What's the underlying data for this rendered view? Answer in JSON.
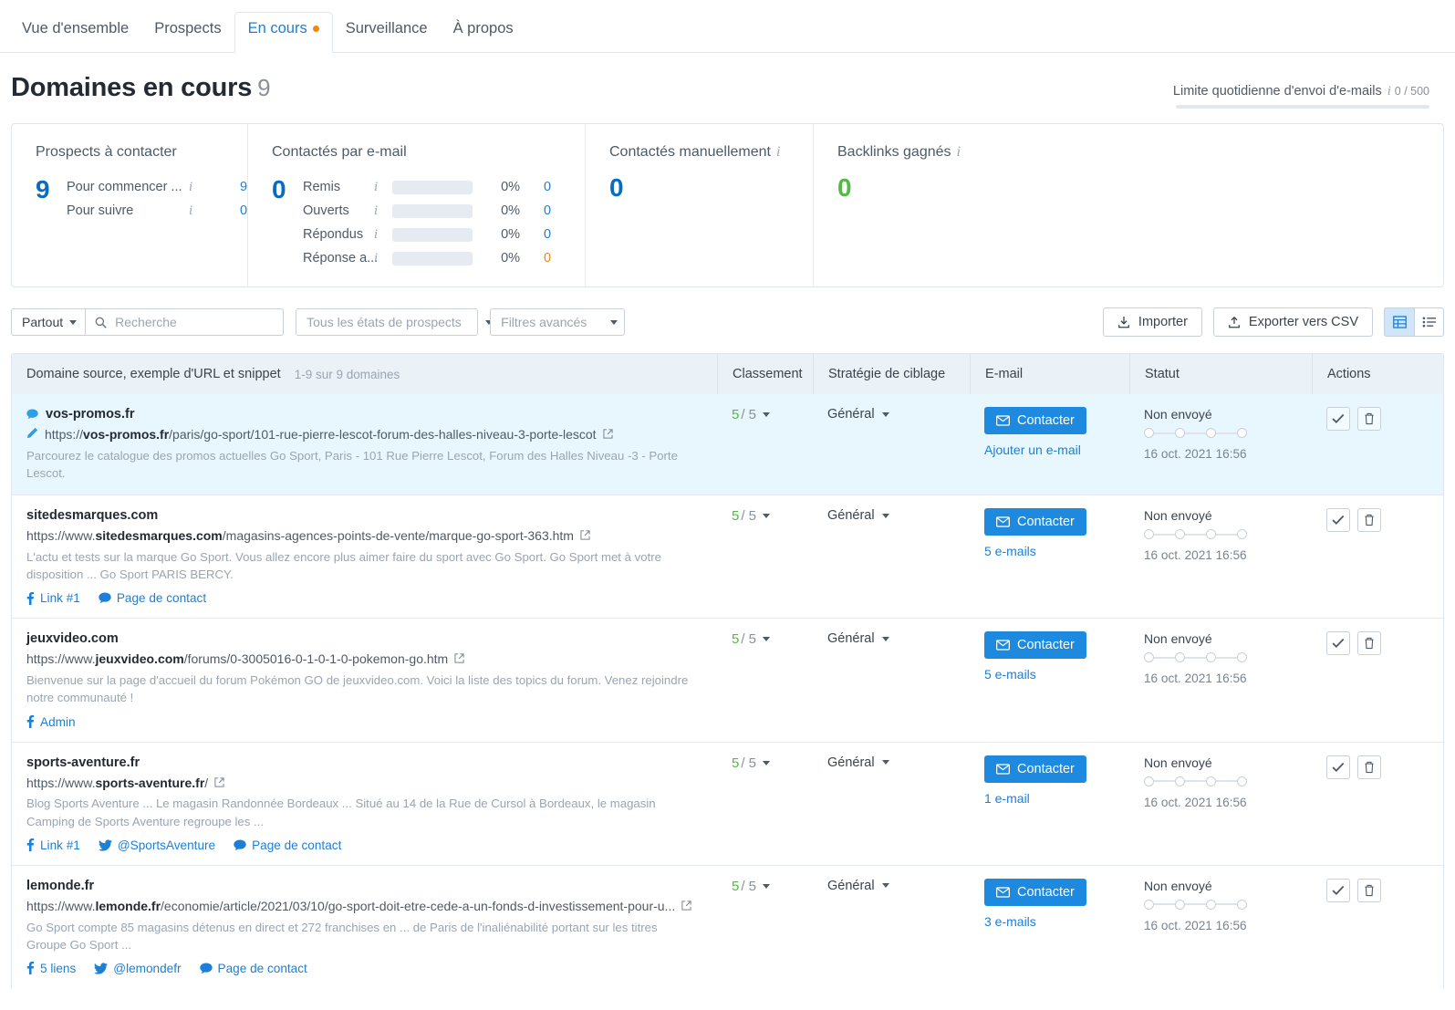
{
  "tabs": [
    {
      "label": "Vue d'ensemble",
      "active": false,
      "dot": false
    },
    {
      "label": "Prospects",
      "active": false,
      "dot": false
    },
    {
      "label": "En cours",
      "active": true,
      "dot": true
    },
    {
      "label": "Surveillance",
      "active": false,
      "dot": false
    },
    {
      "label": "À propos",
      "active": false,
      "dot": false
    }
  ],
  "header": {
    "title": "Domaines en cours",
    "count": "9",
    "limit_label": "Limite quotidienne d'envoi d'e-mails",
    "limit_value": "0 / 500"
  },
  "stats": {
    "prospects": {
      "title": "Prospects à contacter",
      "big": "9",
      "rows": [
        {
          "label": "Pour commencer ...",
          "value": "9"
        },
        {
          "label": "Pour suivre",
          "value": "0"
        }
      ]
    },
    "emailed": {
      "title": "Contactés par e-mail",
      "big": "0",
      "rows": [
        {
          "label": "Remis",
          "pct": "0%",
          "value": "0",
          "orange": false
        },
        {
          "label": "Ouverts",
          "pct": "0%",
          "value": "0",
          "orange": false
        },
        {
          "label": "Répondus",
          "pct": "0%",
          "value": "0",
          "orange": false
        },
        {
          "label": "Réponse a...",
          "pct": "0%",
          "value": "0",
          "orange": true
        }
      ]
    },
    "manual": {
      "title": "Contactés manuellement",
      "big": "0"
    },
    "backlinks": {
      "title": "Backlinks gagnés",
      "big": "0"
    }
  },
  "toolbar": {
    "scope_label": "Partout",
    "search_placeholder": "Recherche",
    "search_value": "",
    "prospect_state_label": "Tous les états de prospects",
    "advanced_filters_label": "Filtres avancés",
    "import_label": "Importer",
    "export_label": "Exporter vers CSV"
  },
  "table": {
    "columns": {
      "domain": "Domaine source, exemple d'URL et snippet",
      "domain_sub": "1-9 sur 9 domaines",
      "rank": "Classement",
      "strategy": "Stratégie de ciblage",
      "email": "E-mail",
      "status": "Statut",
      "actions": "Actions"
    },
    "rows": [
      {
        "highlight": true,
        "has_bubble": true,
        "has_pencil": true,
        "domain": "vos-promos.fr",
        "url_prefix": "https://",
        "url_bold": "vos-promos.fr",
        "url_rest": "/paris/go-sport/101-rue-pierre-lescot-forum-des-halles-niveau-3-porte-lescot",
        "snippet": "Parcourez le catalogue des promos actuelles Go Sport, Paris - 101 Rue Pierre Lescot, Forum des Halles Niveau -3 - Porte Lescot.",
        "links": [],
        "rank_num": "5",
        "rank_den": "/ 5",
        "strategy": "Général",
        "contact_label": "Contacter",
        "email_sub": "Ajouter un e-mail",
        "status": "Non envoyé",
        "status_date": "16 oct. 2021 16:56"
      },
      {
        "highlight": false,
        "has_bubble": false,
        "has_pencil": false,
        "domain": "sitedesmarques.com",
        "url_prefix": "https://www.",
        "url_bold": "sitedesmarques.com",
        "url_rest": "/magasins-agences-points-de-vente/marque-go-sport-363.htm",
        "snippet": "L'actu et tests sur la marque Go Sport. Vous allez encore plus aimer faire du sport avec Go Sport. Go Sport met à votre disposition ... Go Sport PARIS BERCY.",
        "links": [
          {
            "icon": "facebook-icon",
            "label": "Link #1"
          },
          {
            "icon": "speech-bubble-icon",
            "label": "Page de contact"
          }
        ],
        "rank_num": "5",
        "rank_den": "/ 5",
        "strategy": "Général",
        "contact_label": "Contacter",
        "email_sub": "5 e-mails",
        "status": "Non envoyé",
        "status_date": "16 oct. 2021 16:56"
      },
      {
        "highlight": false,
        "has_bubble": false,
        "has_pencil": false,
        "domain": "jeuxvideo.com",
        "url_prefix": "https://www.",
        "url_bold": "jeuxvideo.com",
        "url_rest": "/forums/0-3005016-0-1-0-1-0-pokemon-go.htm",
        "snippet": "Bienvenue sur la page d'accueil du forum Pokémon GO de jeuxvideo.com. Voici la liste des topics du forum. Venez rejoindre notre communauté !",
        "links": [
          {
            "icon": "facebook-icon",
            "label": "Admin"
          }
        ],
        "rank_num": "5",
        "rank_den": "/ 5",
        "strategy": "Général",
        "contact_label": "Contacter",
        "email_sub": "5 e-mails",
        "status": "Non envoyé",
        "status_date": "16 oct. 2021 16:56"
      },
      {
        "highlight": false,
        "has_bubble": false,
        "has_pencil": false,
        "domain": "sports-aventure.fr",
        "url_prefix": "https://www.",
        "url_bold": "sports-aventure.fr",
        "url_rest": "/",
        "snippet": "Blog Sports Aventure ... Le magasin Randonnée Bordeaux ... Situé au 14 de la Rue de Cursol à Bordeaux, le magasin Camping de Sports Aventure regroupe les ...",
        "links": [
          {
            "icon": "facebook-icon",
            "label": "Link #1"
          },
          {
            "icon": "twitter-icon",
            "label": "@SportsAventure"
          },
          {
            "icon": "speech-bubble-icon",
            "label": "Page de contact"
          }
        ],
        "rank_num": "5",
        "rank_den": "/ 5",
        "strategy": "Général",
        "contact_label": "Contacter",
        "email_sub": "1 e-mail",
        "status": "Non envoyé",
        "status_date": "16 oct. 2021 16:56"
      },
      {
        "highlight": false,
        "has_bubble": false,
        "has_pencil": false,
        "domain": "lemonde.fr",
        "url_prefix": "https://www.",
        "url_bold": "lemonde.fr",
        "url_rest": "/economie/article/2021/03/10/go-sport-doit-etre-cede-a-un-fonds-d-investissement-pour-u...",
        "snippet": "Go Sport compte 85 magasins détenus en direct et 272 franchises en ... de Paris de l'inaliénabilité portant sur les titres Groupe Go Sport ...",
        "links": [
          {
            "icon": "facebook-icon",
            "label": "5 liens"
          },
          {
            "icon": "twitter-icon",
            "label": "@lemondefr"
          },
          {
            "icon": "speech-bubble-icon",
            "label": "Page de contact"
          }
        ],
        "rank_num": "5",
        "rank_den": "/ 5",
        "strategy": "Général",
        "contact_label": "Contacter",
        "email_sub": "3 e-mails",
        "status": "Non envoyé",
        "status_date": "16 oct. 2021 16:56"
      }
    ]
  },
  "colors": {
    "accent_blue": "#1d8ae0",
    "link_blue": "#1d7fd6",
    "green": "#53b846",
    "orange": "#f1870a",
    "highlight_row": "#e8f7fe"
  }
}
